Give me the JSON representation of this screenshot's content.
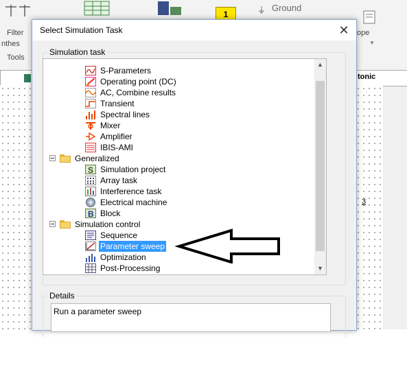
{
  "background_app": {
    "ribbon_labels": [
      "Filter",
      "nthes",
      "Tools"
    ],
    "ribbon_right_label": "ope",
    "badge_number": "1",
    "ground_label": "Ground",
    "tab_right_label": "tonic",
    "right_side_label": "3"
  },
  "dialog": {
    "title": "Select Simulation Task",
    "close_label": "✕",
    "simulation_group_label": "Simulation task",
    "tree_items": [
      {
        "label": "S-Parameters",
        "icon": "s-parameters-icon"
      },
      {
        "label": "Operating point (DC)",
        "icon": "operating-point-icon"
      },
      {
        "label": "AC, Combine results",
        "icon": "ac-icon"
      },
      {
        "label": "Transient",
        "icon": "transient-icon"
      },
      {
        "label": "Spectral lines",
        "icon": "spectral-lines-icon"
      },
      {
        "label": "Mixer",
        "icon": "mixer-icon"
      },
      {
        "label": "Amplifier",
        "icon": "amplifier-icon"
      },
      {
        "label": "IBIS-AMI",
        "icon": "ibis-ami-icon"
      },
      {
        "label": "Generalized",
        "icon": "folder-icon",
        "folder": true
      },
      {
        "label": "Simulation project",
        "icon": "simulation-project-icon"
      },
      {
        "label": "Array task",
        "icon": "array-task-icon"
      },
      {
        "label": "Interference task",
        "icon": "interference-task-icon"
      },
      {
        "label": "Electrical machine",
        "icon": "electrical-machine-icon"
      },
      {
        "label": "Block",
        "icon": "block-icon"
      },
      {
        "label": "Simulation control",
        "icon": "folder-icon",
        "folder": true
      },
      {
        "label": "Sequence",
        "icon": "sequence-icon"
      },
      {
        "label": "Parameter sweep",
        "icon": "parameter-sweep-icon",
        "selected": true
      },
      {
        "label": "Optimization",
        "icon": "optimization-icon"
      },
      {
        "label": "Post-Processing",
        "icon": "post-processing-icon"
      }
    ],
    "details_group_label": "Details",
    "details_text": "Run a parameter sweep"
  },
  "colors": {
    "selection": "#3399ff",
    "arrow_outline": "#000000"
  }
}
